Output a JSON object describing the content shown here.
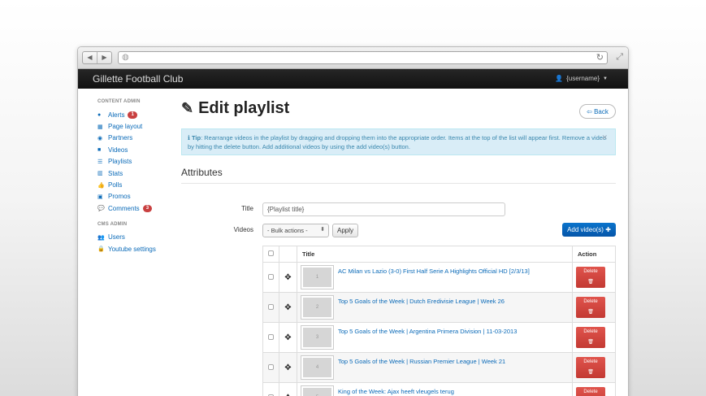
{
  "browser": {
    "url": ""
  },
  "navbar": {
    "brand": "Gillette Football Club",
    "user": "{username}"
  },
  "sidebar": {
    "section1": "CONTENT ADMIN",
    "items1": [
      {
        "label": "Alerts",
        "badge": "1",
        "icon": "exclamation-circle-icon"
      },
      {
        "label": "Page layout",
        "icon": "grid-icon"
      },
      {
        "label": "Partners",
        "icon": "globe-icon"
      },
      {
        "label": "Videos",
        "icon": "video-camera-icon"
      },
      {
        "label": "Playlists",
        "icon": "list-icon"
      },
      {
        "label": "Stats",
        "icon": "bar-chart-icon"
      },
      {
        "label": "Polls",
        "icon": "thumbs-up-icon"
      },
      {
        "label": "Promos",
        "icon": "picture-icon"
      },
      {
        "label": "Comments",
        "badge": "3",
        "icon": "comment-icon"
      }
    ],
    "section2": "CMS ADMIN",
    "items2": [
      {
        "label": "Users",
        "icon": "users-icon"
      },
      {
        "label": "Youtube settings",
        "icon": "lock-icon"
      }
    ]
  },
  "main": {
    "title": "Edit playlist",
    "back_label": "Back",
    "tip_label": "Tip",
    "tip_text": ": Rearrange videos in the playlist by dragging and dropping them into the appropriate order. Items at the top of the list will appear first. Remove a video by hitting the delete button. Add additional videos by using the add video(s) button.",
    "attributes_heading": "Attributes",
    "title_label": "Title",
    "title_value": "{Playlist title}",
    "videos_label": "Videos",
    "bulk_value": "- Bulk actions -",
    "apply_label": "Apply",
    "add_label": "Add video(s)"
  },
  "table": {
    "col_title": "Title",
    "col_action": "Action",
    "delete_label": "Delete",
    "rows": [
      {
        "num": "1",
        "title": "AC Milan vs Lazio (3-0) First Half Serie A Highlights Official HD [2/3/13]"
      },
      {
        "num": "2",
        "title": "Top 5 Goals of the Week | Dutch Eredivisie League | Week 26"
      },
      {
        "num": "3",
        "title": "Top 5 Goals of the Week | Argentina Primera Division | 11-03-2013"
      },
      {
        "num": "4",
        "title": "Top 5 Goals of the Week | Russian Premier League | Week 21"
      },
      {
        "num": "5",
        "title": "King of the Week: Ajax heeft vleugels terug"
      }
    ]
  }
}
